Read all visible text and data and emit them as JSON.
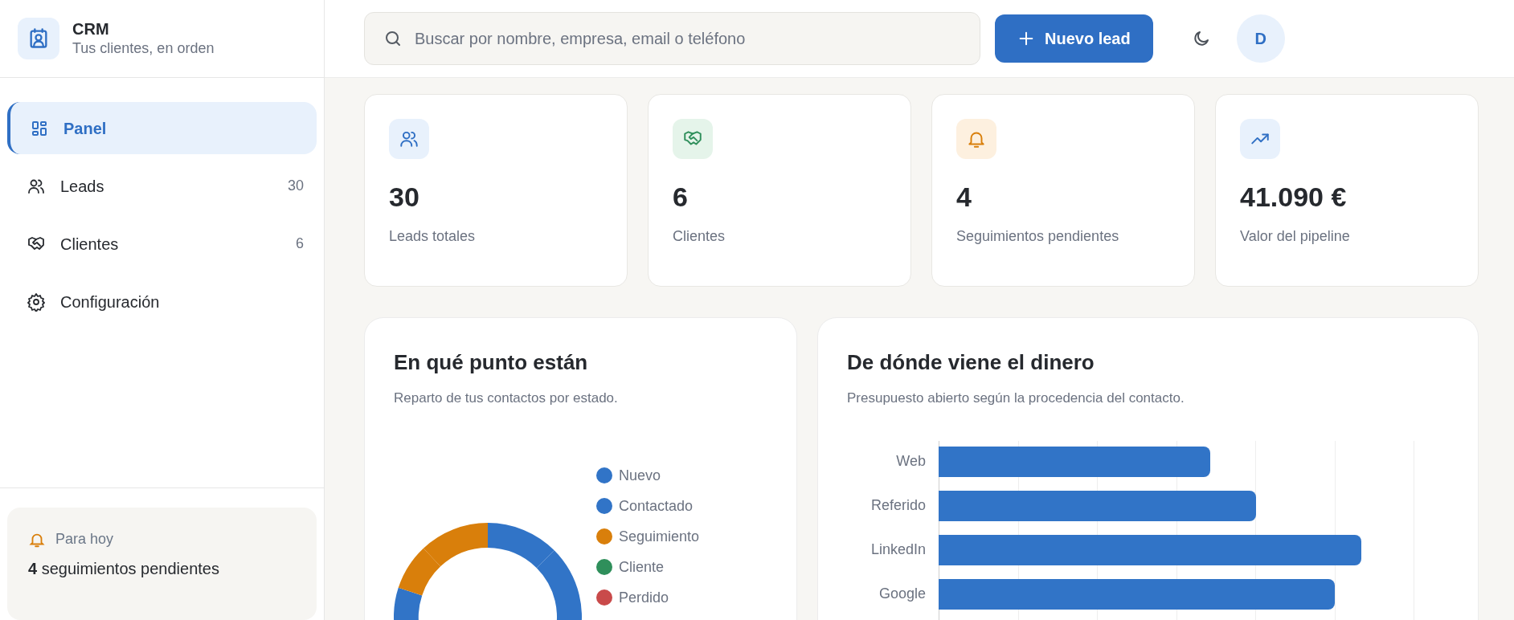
{
  "brand": {
    "title": "CRM",
    "subtitle": "Tus clientes, en orden"
  },
  "nav": [
    {
      "kind": "panel",
      "label": "Panel",
      "selected": true
    },
    {
      "kind": "leads",
      "label": "Leads",
      "count": "30",
      "selected": false
    },
    {
      "kind": "clients",
      "label": "Clientes",
      "count": "6",
      "selected": false
    },
    {
      "kind": "settings",
      "label": "Configuración",
      "selected": false
    }
  ],
  "today": {
    "title": "Para hoy",
    "count": "4",
    "text": "seguimientos pendientes"
  },
  "search": {
    "placeholder": "Buscar por nombre, empresa, email o teléfono"
  },
  "new_button": {
    "label": "Nuevo lead"
  },
  "avatar": {
    "initial": "D"
  },
  "stats": [
    {
      "kind": "leads",
      "value": "30",
      "label": "Leads totales"
    },
    {
      "kind": "clients",
      "value": "6",
      "label": "Clientes"
    },
    {
      "kind": "followups",
      "value": "4",
      "label": "Seguimientos pendientes"
    },
    {
      "kind": "pipeline",
      "value": "41.090 €",
      "label": "Valor del pipeline"
    }
  ],
  "status_chart": {
    "title": "En qué punto están",
    "subtitle": "Reparto de tus contactos por estado.",
    "legend": [
      {
        "label": "Nuevo",
        "color": "#3174c7"
      },
      {
        "label": "Contactado",
        "color": "#3174c7"
      },
      {
        "label": "Seguimiento",
        "color": "#d97f0b"
      },
      {
        "label": "Cliente",
        "color": "#2f8f5b"
      },
      {
        "label": "Perdido",
        "color": "#c94a4a"
      }
    ]
  },
  "source_chart": {
    "title": "De dónde viene el dinero",
    "subtitle": "Presupuesto abierto según la procedencia del contacto.",
    "categories": [
      "Web",
      "Referido",
      "LinkedIn",
      "Google"
    ]
  }
}
